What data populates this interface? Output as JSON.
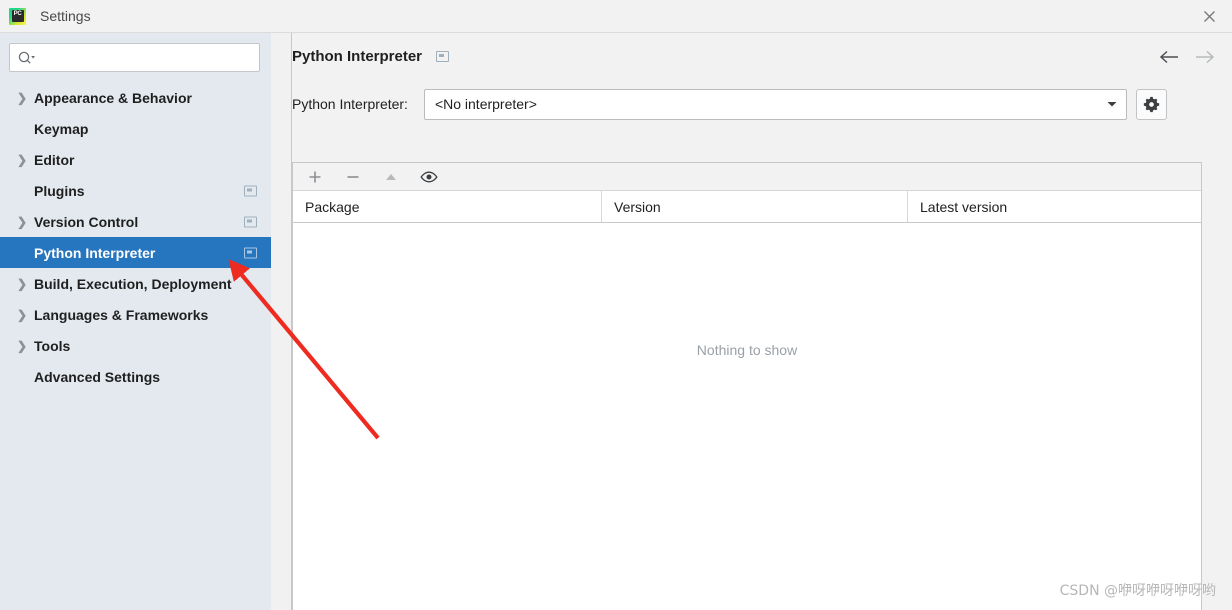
{
  "window": {
    "title": "Settings",
    "app_icon": "pycharm-icon",
    "app_icon_text": "PC",
    "close_icon": "close-icon",
    "colors": {
      "selection_blue": "#2675bf",
      "sidebar_bg": "#e3e9ee",
      "panel_bg": "#f2f2f2",
      "annotation_red": "#ee2b21"
    }
  },
  "sidebar": {
    "search": {
      "placeholder": "",
      "value": "",
      "icon": "search-icon"
    },
    "items": [
      {
        "label": "Appearance & Behavior",
        "expandable": true,
        "badge": false,
        "selected": false
      },
      {
        "label": "Keymap",
        "expandable": false,
        "badge": false,
        "selected": false
      },
      {
        "label": "Editor",
        "expandable": true,
        "badge": false,
        "selected": false
      },
      {
        "label": "Plugins",
        "expandable": false,
        "badge": true,
        "selected": false
      },
      {
        "label": "Version Control",
        "expandable": true,
        "badge": true,
        "selected": false
      },
      {
        "label": "Python Interpreter",
        "expandable": false,
        "badge": true,
        "selected": true
      },
      {
        "label": "Build, Execution, Deployment",
        "expandable": true,
        "badge": false,
        "selected": false
      },
      {
        "label": "Languages & Frameworks",
        "expandable": true,
        "badge": false,
        "selected": false
      },
      {
        "label": "Tools",
        "expandable": true,
        "badge": false,
        "selected": false
      },
      {
        "label": "Advanced Settings",
        "expandable": false,
        "badge": false,
        "selected": false
      }
    ]
  },
  "main": {
    "title": "Python Interpreter",
    "title_badge_icon": "project-scope-badge-icon",
    "nav": {
      "back_icon": "arrow-left-icon",
      "forward_icon": "arrow-right-icon"
    },
    "interpreter": {
      "label": "Python Interpreter:",
      "value": "<No interpreter>",
      "dropdown_icon": "chevron-down-icon",
      "settings_icon": "gear-icon"
    },
    "packages": {
      "toolbar": [
        {
          "icon": "plus-icon",
          "name": "install-package-button"
        },
        {
          "icon": "minus-icon",
          "name": "uninstall-package-button"
        },
        {
          "icon": "arrow-up-icon",
          "name": "upgrade-package-button"
        },
        {
          "icon": "eye-icon",
          "name": "show-early-releases-button"
        }
      ],
      "columns": [
        "Package",
        "Version",
        "Latest version"
      ],
      "rows": [],
      "empty_message": "Nothing to show"
    }
  },
  "watermark": "CSDN @咿呀咿呀咿呀哟"
}
